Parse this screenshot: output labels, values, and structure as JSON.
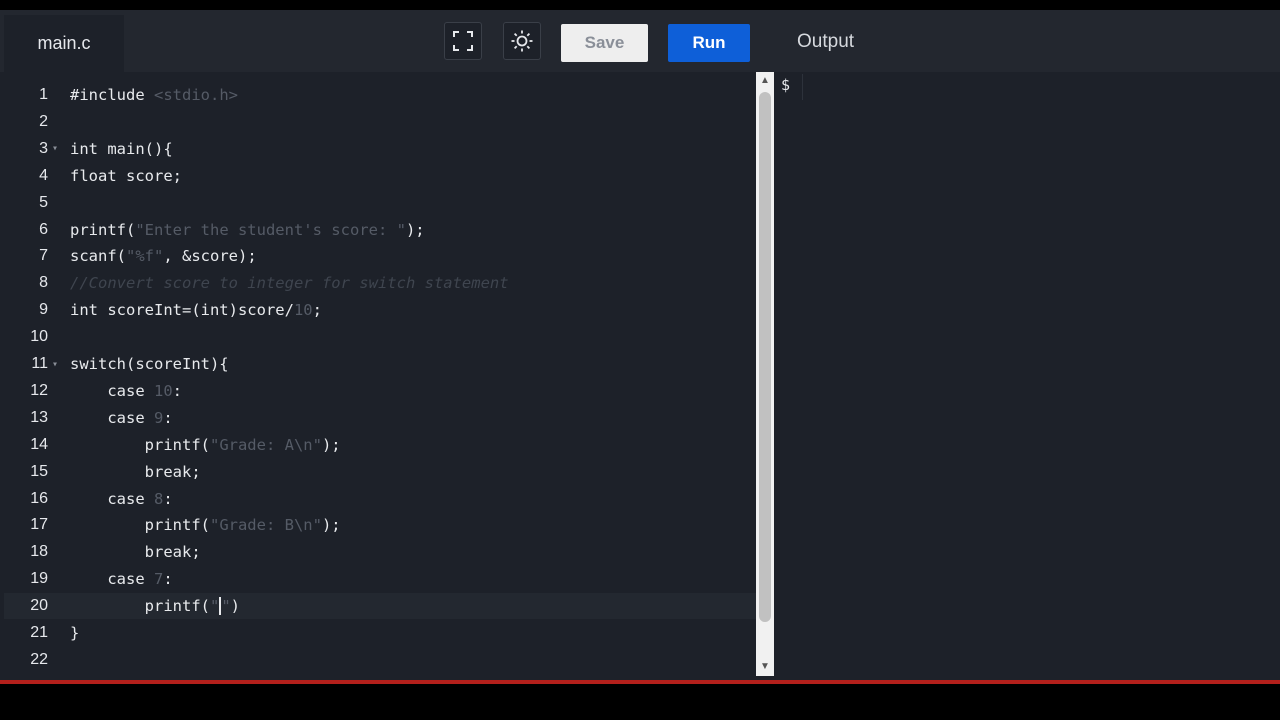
{
  "editor_tab": {
    "filename": "main.c"
  },
  "toolbar": {
    "fullscreen_icon": "expand-icon",
    "theme_icon": "sun-icon",
    "save_label": "Save",
    "run_label": "Run"
  },
  "output": {
    "title": "Output",
    "prompt": "$"
  },
  "code": {
    "lines": [
      {
        "num": "1",
        "text": "#include <stdio.h>"
      },
      {
        "num": "2",
        "text": ""
      },
      {
        "num": "3",
        "text": "int main(){"
      },
      {
        "num": "4",
        "text": "float score;"
      },
      {
        "num": "5",
        "text": ""
      },
      {
        "num": "6",
        "text": "printf(\"Enter the student's score: \");"
      },
      {
        "num": "7",
        "text": "scanf(\"%f\", &score);"
      },
      {
        "num": "8",
        "text": "//Convert score to integer for switch statement"
      },
      {
        "num": "9",
        "text": "int scoreInt=(int)score/10;"
      },
      {
        "num": "10",
        "text": ""
      },
      {
        "num": "11",
        "text": "switch(scoreInt){"
      },
      {
        "num": "12",
        "text": "    case 10:"
      },
      {
        "num": "13",
        "text": "    case 9:"
      },
      {
        "num": "14",
        "text": "        printf(\"Grade: A\\n\");"
      },
      {
        "num": "15",
        "text": "        break;"
      },
      {
        "num": "16",
        "text": "    case 8:"
      },
      {
        "num": "17",
        "text": "        printf(\"Grade: B\\n\");"
      },
      {
        "num": "18",
        "text": "        break;"
      },
      {
        "num": "19",
        "text": "    case 7:"
      },
      {
        "num": "20",
        "text": "        printf(\"\")"
      },
      {
        "num": "21",
        "text": "}"
      },
      {
        "num": "22",
        "text": ""
      }
    ]
  },
  "colors": {
    "accent": "#0e5fd8",
    "background": "#1d2129"
  }
}
